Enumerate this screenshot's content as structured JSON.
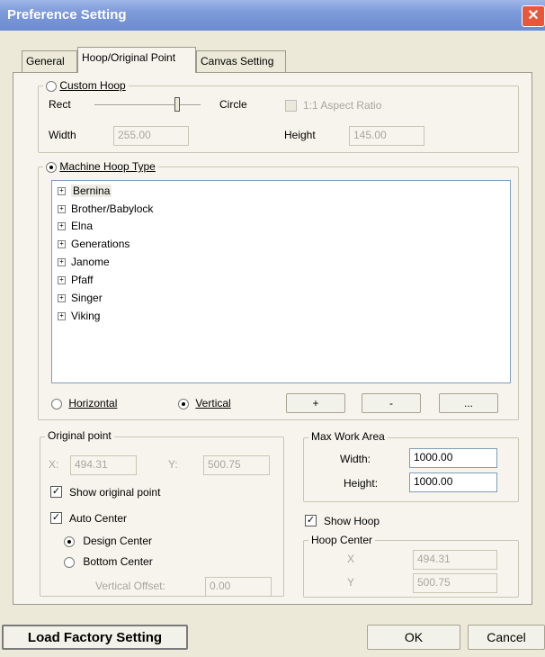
{
  "window": {
    "title": "Preference Setting",
    "close_label": "✕"
  },
  "tabs": [
    {
      "label": "General",
      "active": false
    },
    {
      "label": "Hoop/Original Point",
      "active": true
    },
    {
      "label": "Canvas Setting",
      "active": false
    }
  ],
  "custom_hoop": {
    "label": "Custom Hoop",
    "selected": false,
    "rect_label": "Rect",
    "circle_label": "Circle",
    "aspect_label": "1:1 Aspect Ratio",
    "width_label": "Width",
    "width_value": "255.00",
    "height_label": "Height",
    "height_value": "145.00"
  },
  "machine_hoop": {
    "label": "Machine Hoop Type",
    "selected": true,
    "items": [
      "Bernina",
      "Brother/Babylock",
      "Elna",
      "Generations",
      "Janome",
      "Pfaff",
      "Singer",
      "Viking"
    ],
    "horizontal_label": "Horizontal",
    "vertical_label": "Vertical",
    "orientation": "Vertical",
    "add_button": "+",
    "remove_button": "-",
    "more_button": "..."
  },
  "original_point": {
    "label": "Original point",
    "x_label": "X:",
    "x_value": "494.31",
    "y_label": "Y:",
    "y_value": "500.75",
    "show_label": "Show original point",
    "show_checked": true,
    "auto_center_label": "Auto Center",
    "auto_center_checked": true,
    "design_center_label": "Design Center",
    "bottom_center_label": "Bottom Center",
    "center_mode": "Design Center",
    "offset_label": "Vertical Offset:",
    "offset_value": "0.00"
  },
  "max_work_area": {
    "label": "Max Work Area",
    "width_label": "Width:",
    "width_value": "1000.00",
    "height_label": "Height:",
    "height_value": "1000.00"
  },
  "show_hoop": {
    "label": "Show Hoop",
    "checked": true
  },
  "hoop_center": {
    "label": "Hoop Center",
    "x_label": "X",
    "x_value": "494.31",
    "y_label": "Y",
    "y_value": "500.75"
  },
  "buttons": {
    "load_factory": "Load Factory Setting",
    "ok": "OK",
    "cancel": "Cancel"
  },
  "colors": {
    "title_bar": "#7d9ad9",
    "close_button": "#e8573a",
    "dialog_bg": "#ece9d8"
  }
}
